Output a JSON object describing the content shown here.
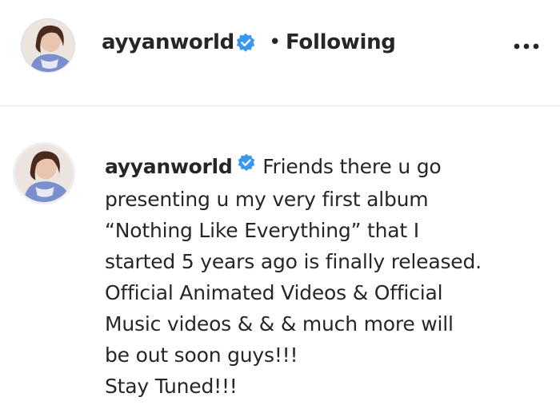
{
  "post_header": {
    "username": "ayyanworld",
    "separator": "•",
    "follow_status": "Following",
    "verified_icon": "verified-badge-icon",
    "more_icon": "more-options-icon"
  },
  "comment": {
    "username": "ayyanworld",
    "verified_icon": "verified-badge-icon",
    "lines": [
      "Friends there u go",
      "presenting u my very first album",
      "“Nothing Like Everything” that I",
      "started 5 years ago is finally released.",
      "Official Animated Videos & Official",
      "Music videos & & & much more will",
      "be out soon guys!!!",
      "Stay Tuned!!!"
    ]
  },
  "colors": {
    "verified_blue": "#3897f0",
    "text": "#262626",
    "divider": "#e6e6e6"
  }
}
